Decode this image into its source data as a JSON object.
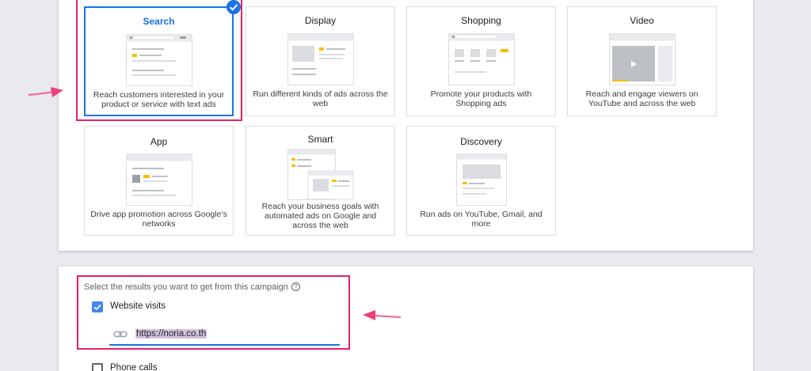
{
  "campaign_types": {
    "cards": [
      {
        "title": "Search",
        "description": "Reach customers interested in your product or service with text ads",
        "selected": true,
        "illustration": "search-ad-illustration"
      },
      {
        "title": "Display",
        "description": "Run different kinds of ads across the web",
        "selected": false,
        "illustration": "display-ad-illustration"
      },
      {
        "title": "Shopping",
        "description": "Promote your products with Shopping ads",
        "selected": false,
        "illustration": "shopping-ad-illustration"
      },
      {
        "title": "Video",
        "description": "Reach and engage viewers on YouTube and across the web",
        "selected": false,
        "illustration": "video-ad-illustration"
      },
      {
        "title": "App",
        "description": "Drive app promotion across Google's networks",
        "selected": false,
        "illustration": "app-ad-illustration"
      },
      {
        "title": "Smart",
        "description": "Reach your business goals with automated ads on Google and across the web",
        "selected": false,
        "illustration": "smart-ad-illustration"
      },
      {
        "title": "Discovery",
        "description": "Run ads on YouTube, Gmail, and more",
        "selected": false,
        "illustration": "discovery-ad-illustration"
      }
    ]
  },
  "results": {
    "prompt": "Select the results you want to get from this campaign",
    "help_icon": "help-icon",
    "options": [
      {
        "label": "Website visits",
        "checked": true
      },
      {
        "label": "Phone calls",
        "checked": false
      }
    ],
    "website_url": "https://noria.co.th",
    "link_icon": "link-icon"
  },
  "colors": {
    "accent": "#1a73e8",
    "highlight": "#e91e63",
    "yellow": "#fbbc04"
  }
}
